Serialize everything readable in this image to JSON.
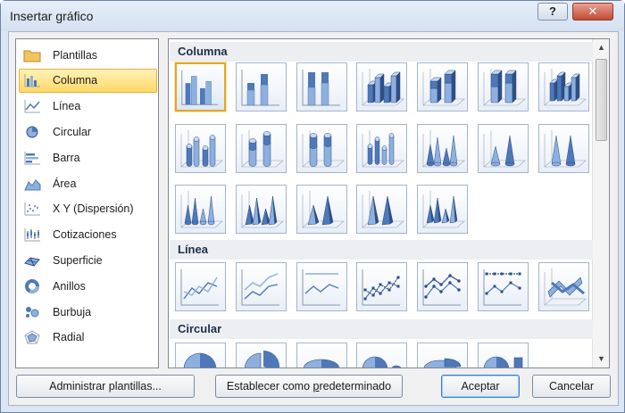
{
  "window": {
    "title": "Insertar gráfico",
    "help_label": "?",
    "close_label": "✕"
  },
  "categories": [
    {
      "label": "Plantillas",
      "icon": "folder-icon"
    },
    {
      "label": "Columna",
      "icon": "column-chart-icon",
      "selected": true
    },
    {
      "label": "Línea",
      "icon": "line-chart-icon"
    },
    {
      "label": "Circular",
      "icon": "pie-chart-icon"
    },
    {
      "label": "Barra",
      "icon": "bar-chart-icon"
    },
    {
      "label": "Área",
      "icon": "area-chart-icon"
    },
    {
      "label": "X Y (Dispersión)",
      "icon": "scatter-chart-icon"
    },
    {
      "label": "Cotizaciones",
      "icon": "stock-chart-icon"
    },
    {
      "label": "Superficie",
      "icon": "surface-chart-icon"
    },
    {
      "label": "Anillos",
      "icon": "doughnut-chart-icon"
    },
    {
      "label": "Burbuja",
      "icon": "bubble-chart-icon"
    },
    {
      "label": "Radial",
      "icon": "radar-chart-icon"
    }
  ],
  "sections": [
    {
      "title": "Columna",
      "subtypes": [
        "clustered-column",
        "stacked-column",
        "100-stacked-column",
        "3d-clustered-column",
        "3d-stacked-column",
        "3d-100-stacked-column",
        "3d-column",
        "clustered-cylinder",
        "stacked-cylinder",
        "100-stacked-cylinder",
        "3d-cylinder",
        "clustered-cone",
        "stacked-cone",
        "100-stacked-cone",
        "3d-cone",
        "clustered-pyramid",
        "stacked-pyramid",
        "100-stacked-pyramid",
        "3d-pyramid"
      ]
    },
    {
      "title": "Línea",
      "subtypes": [
        "line",
        "stacked-line",
        "100-stacked-line",
        "line-markers",
        "stacked-line-markers",
        "100-stacked-line-markers",
        "3d-line"
      ]
    },
    {
      "title": "Circular",
      "subtypes": [
        "pie",
        "exploded-pie",
        "3d-pie",
        "pie-of-pie",
        "exploded-3d-pie",
        "bar-of-pie"
      ]
    }
  ],
  "buttons": {
    "manage_templates": "Administrar plantillas...",
    "set_default_pre": "Establecer como ",
    "set_default_u": "p",
    "set_default_post": "redeterminado",
    "accept": "Aceptar",
    "cancel": "Cancelar"
  },
  "colors": {
    "accent": "#ffd967",
    "chart_blue": "#4f78b8",
    "selection": "#e3a72b"
  }
}
